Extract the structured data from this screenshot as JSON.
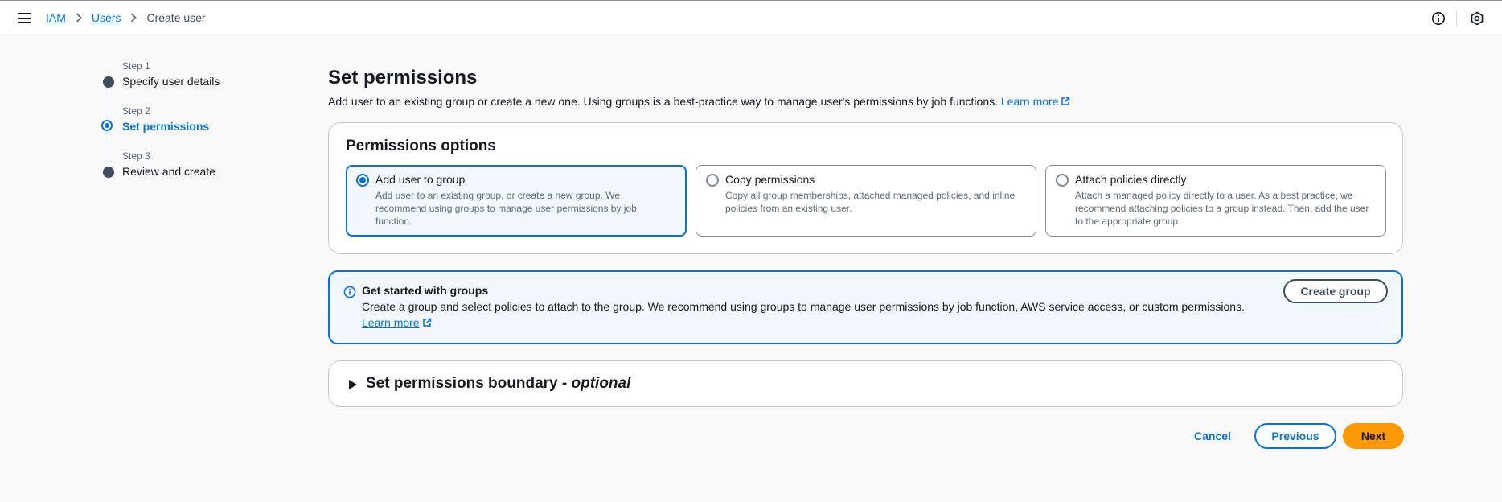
{
  "header": {
    "breadcrumb": [
      {
        "label": "IAM"
      },
      {
        "label": "Users"
      },
      {
        "label": "Create user"
      }
    ],
    "icons": [
      "menu-icon",
      "info-icon",
      "settings-icon"
    ]
  },
  "steps": [
    {
      "number": "Step 1",
      "label": "Specify user details",
      "state": "completed"
    },
    {
      "number": "Step 2",
      "label": "Set permissions",
      "state": "active"
    },
    {
      "number": "Step 3",
      "label": "Review and create",
      "state": "pending"
    }
  ],
  "page": {
    "title": "Set permissions",
    "description": "Add user to an existing group or create a new one. Using groups is a best-practice way to manage user's permissions by job functions.",
    "learn_more": "Learn more"
  },
  "permissions_options": {
    "title": "Permissions options",
    "selected": "Add user to group",
    "options": [
      {
        "title": "Add user to group",
        "description": "Add user to an existing group, or create a new group. We recommend using groups to manage user permissions by job function."
      },
      {
        "title": "Copy permissions",
        "description": "Copy all group memberships, attached managed policies, and inline policies from an existing user."
      },
      {
        "title": "Attach policies directly",
        "description": "Attach a managed policy directly to a user. As a best practice, we recommend attaching policies to a group instead. Then, add the user to the appropriate group."
      }
    ]
  },
  "alert": {
    "title": "Get started with groups",
    "text": "Create a group and select policies to attach to the group. We recommend using groups to manage user permissions by job function, AWS service access, or custom permissions.",
    "link": "Learn more",
    "button": "Create group"
  },
  "boundary": {
    "title": "Set permissions boundary - ",
    "optional": "optional"
  },
  "footer": {
    "cancel": "Cancel",
    "previous": "Previous",
    "next": "Next"
  },
  "colors": {
    "accent": "#0972d3",
    "primary_button": "#ff9900",
    "text": "#16191f"
  }
}
